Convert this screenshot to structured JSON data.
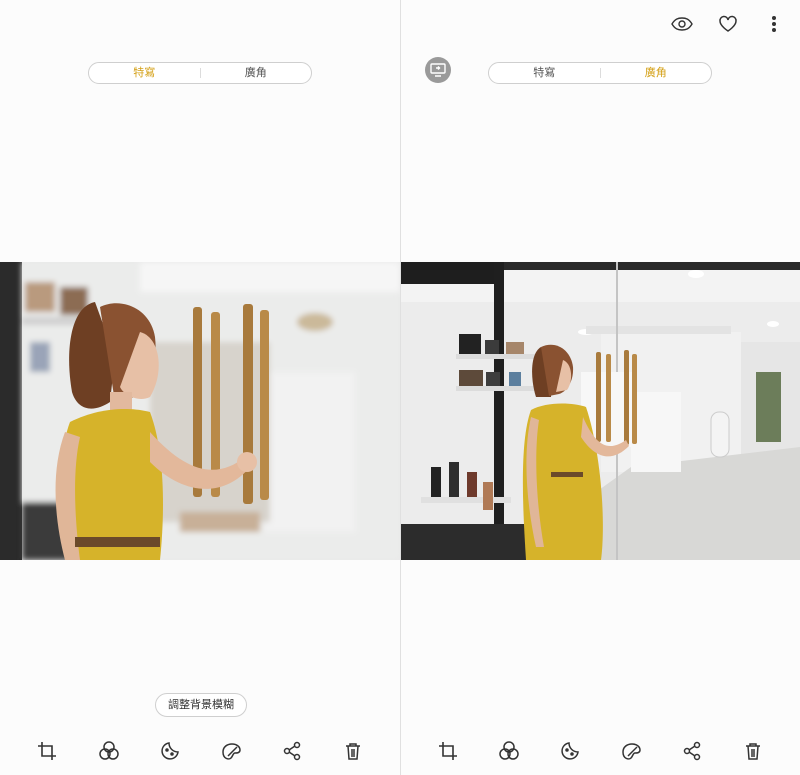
{
  "left_panel": {
    "segment": {
      "option_closeup": "特寫",
      "option_wide": "廣角",
      "active": "closeup"
    },
    "adjust_blur_label": "調整背景模糊",
    "toolbar": [
      "crop-icon",
      "filter-icon",
      "sticker-icon",
      "draw-icon",
      "share-icon",
      "delete-icon"
    ]
  },
  "right_panel": {
    "segment": {
      "option_closeup": "特寫",
      "option_wide": "廣角",
      "active": "wide"
    },
    "top_icons": [
      "eye-icon",
      "heart-icon",
      "more-vertical-icon"
    ],
    "toolbar": [
      "crop-icon",
      "filter-icon",
      "sticker-icon",
      "draw-icon",
      "share-icon",
      "delete-icon"
    ]
  },
  "colors": {
    "accent": "#d4a017",
    "dress": "#d6b32a",
    "door_handle": "#a87a3c"
  }
}
